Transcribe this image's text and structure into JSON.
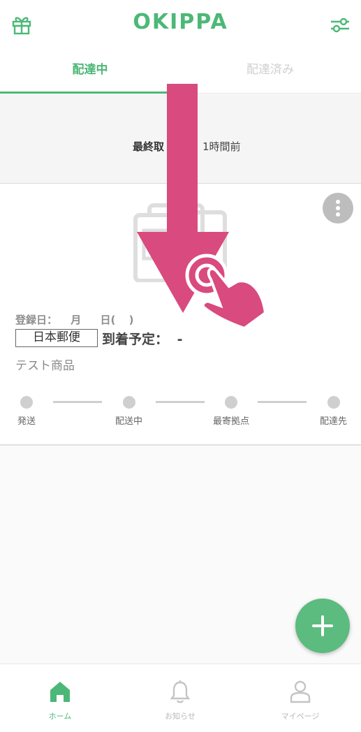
{
  "header": {
    "logo": "OKIPPA",
    "gift_icon": "gift-icon",
    "filter_icon": "sliders-icon"
  },
  "tabs": [
    {
      "label": "配達中",
      "active": true
    },
    {
      "label": "配達済み",
      "active": false
    }
  ],
  "sync": {
    "label": "最終取",
    "time": "1時間前"
  },
  "package": {
    "registered_label": "登録日：",
    "registered_month": "月",
    "registered_day": "日(",
    "registered_close": ")",
    "carrier": "日本郵便",
    "arrival_label": "到着予定：",
    "arrival_value": "-",
    "item_name": "テスト商品",
    "steps": [
      {
        "label": "発送"
      },
      {
        "label": "配送中"
      },
      {
        "label": "最寄拠点"
      },
      {
        "label": "配達先"
      }
    ]
  },
  "overlay": {
    "gesture": "swipe-down-arrow",
    "color": "#d94a7e"
  },
  "fab": {
    "icon": "plus-icon"
  },
  "bottom_nav": [
    {
      "label": "ホーム",
      "icon": "home-icon",
      "active": true
    },
    {
      "label": "お知らせ",
      "icon": "bell-icon",
      "active": false
    },
    {
      "label": "マイページ",
      "icon": "user-icon",
      "active": false
    }
  ],
  "colors": {
    "brand": "#4cb877",
    "overlay": "#d94a7e",
    "inactive": "#cfcfcf"
  }
}
